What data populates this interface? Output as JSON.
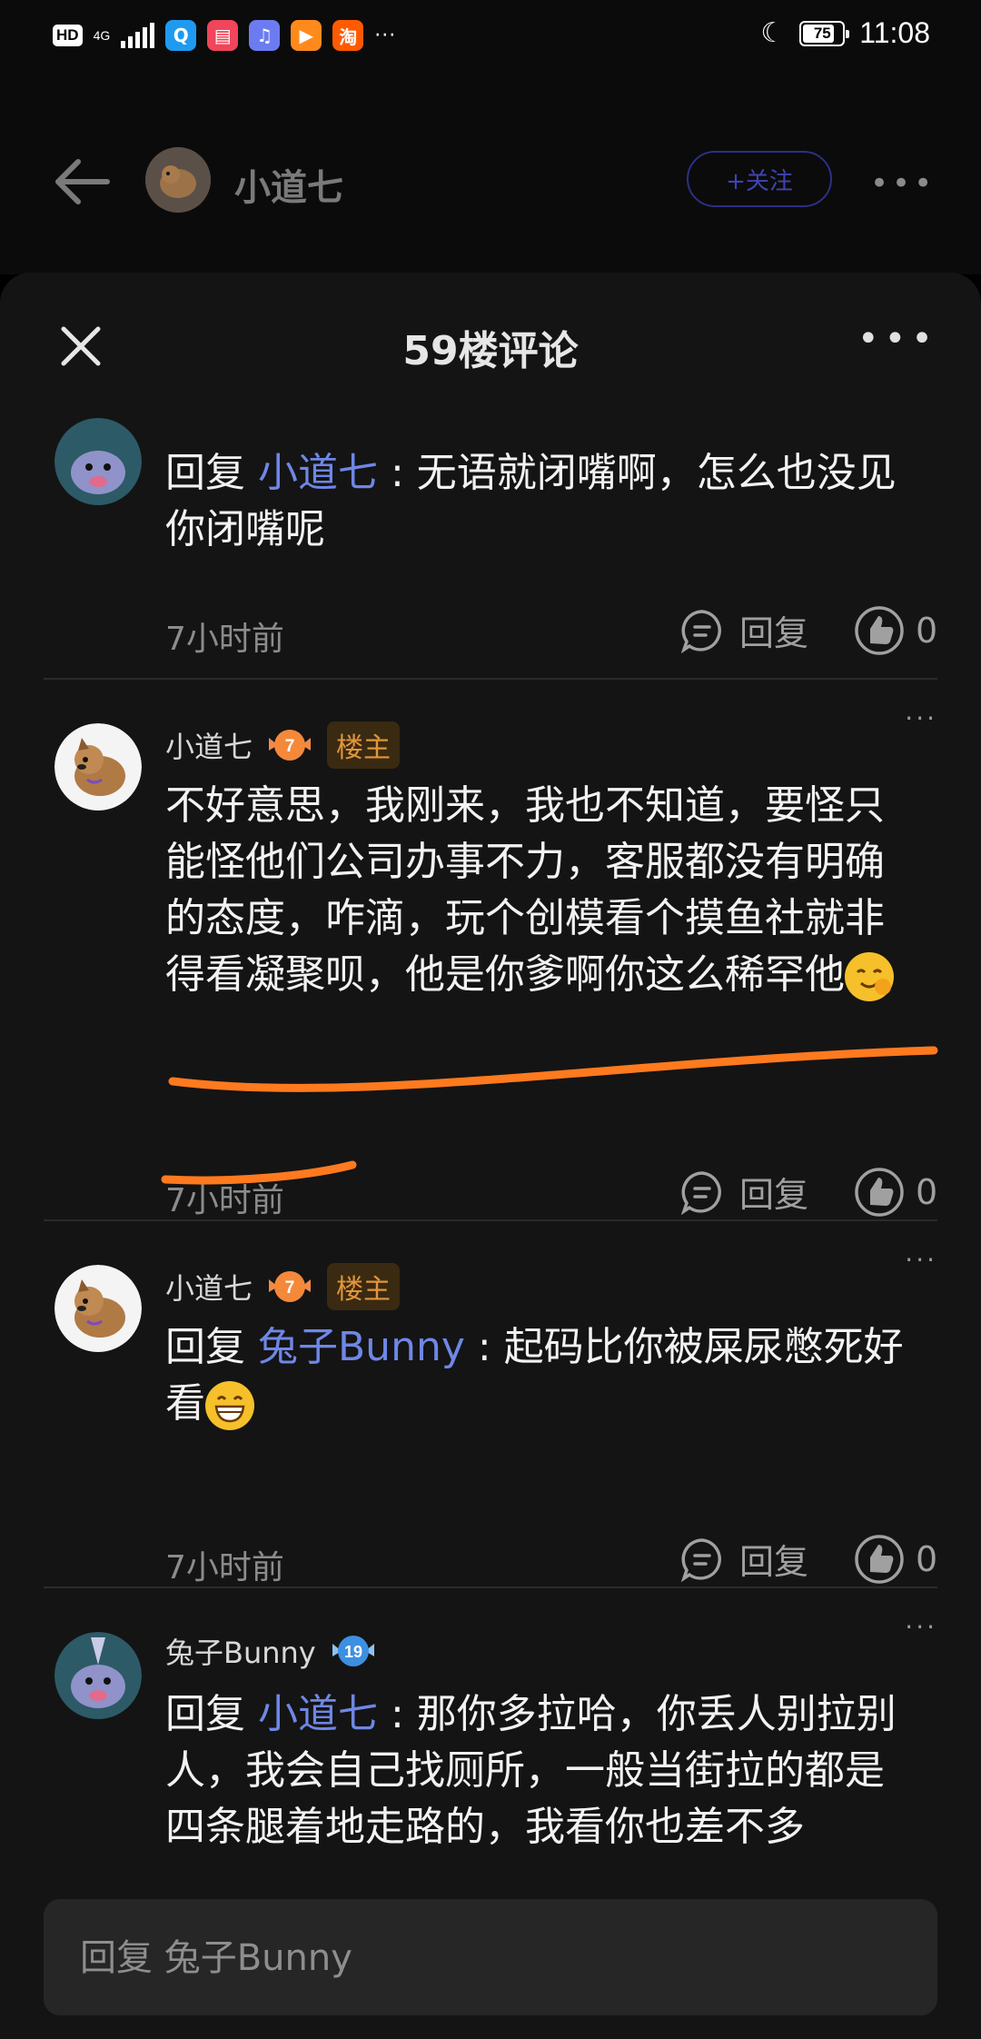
{
  "status_bar": {
    "hd": "HD",
    "network": "4G",
    "apps": [
      {
        "icon": "search-app-icon",
        "glyph": "Q",
        "color": "#1e9bf0"
      },
      {
        "icon": "book-app-icon",
        "glyph": "▤",
        "color": "#f0455a"
      },
      {
        "icon": "music-app-icon",
        "glyph": "♫",
        "color": "#6c7cf0"
      },
      {
        "icon": "video-app-icon",
        "glyph": "▶",
        "color": "#ff8a1c"
      },
      {
        "icon": "taobao-app-icon",
        "glyph": "淘",
        "color": "#ff5a00"
      }
    ],
    "more": "···",
    "battery": "75",
    "time": "11:08"
  },
  "top_nav": {
    "name": "小道七",
    "follow_label": "+关注",
    "more": "•••"
  },
  "sheet": {
    "title": "59楼评论",
    "more": "•••"
  },
  "comments": [
    {
      "name": "",
      "prefix": "回复 ",
      "mention": "小道七",
      "text": " : 无语就闭嘴啊，怎么也没见你闭嘴呢",
      "time": "7小时前",
      "reply": "回复",
      "likes": "0"
    },
    {
      "name": "小道七",
      "level": "7",
      "tag": "楼主",
      "text": "不好意思，我刚来，我也不知道，要怪只能怪他们公司办事不力，客服都没有明确的态度，咋滴，玩个创模看个摸鱼社就非得看凝聚呗，他是你爹啊你这么稀罕他",
      "time": "7小时前",
      "reply": "回复",
      "likes": "0"
    },
    {
      "name": "小道七",
      "level": "7",
      "tag": "楼主",
      "prefix": "回复 ",
      "mention": "兔子Bunny",
      "text": " : 起码比你被屎尿憋死好看",
      "time": "7小时前",
      "reply": "回复",
      "likes": "0"
    },
    {
      "name": "兔子Bunny",
      "level": "19",
      "prefix": "回复 ",
      "mention": "小道七",
      "text": " : 那你多拉哈，你丢人别拉别人，我会自己找厕所，一般当街拉的都是四条腿着地走路的，我看你也差不多"
    }
  ],
  "reply_input": {
    "placeholder": "回复 兔子Bunny"
  }
}
